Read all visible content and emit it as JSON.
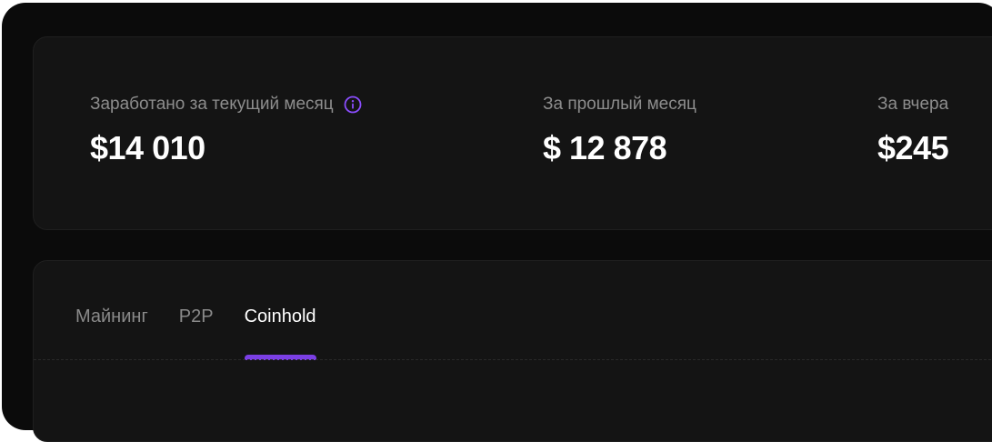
{
  "stats": {
    "current_month": {
      "label": "Заработано за текущий месяц",
      "value": "$14 010",
      "icon": "info-icon"
    },
    "last_month": {
      "label": "За прошлый месяц",
      "value": "$ 12 878"
    },
    "yesterday": {
      "label": "За вчера",
      "value": "$245"
    }
  },
  "tabs": [
    {
      "label": "Майнинг",
      "active": false
    },
    {
      "label": "P2P",
      "active": false
    },
    {
      "label": "Coinhold",
      "active": true
    }
  ],
  "colors": {
    "background": "#0b0b0b",
    "card": "#141414",
    "accent": "#7b3fe4",
    "text_primary": "#ffffff",
    "text_muted": "#8d8d8d"
  }
}
